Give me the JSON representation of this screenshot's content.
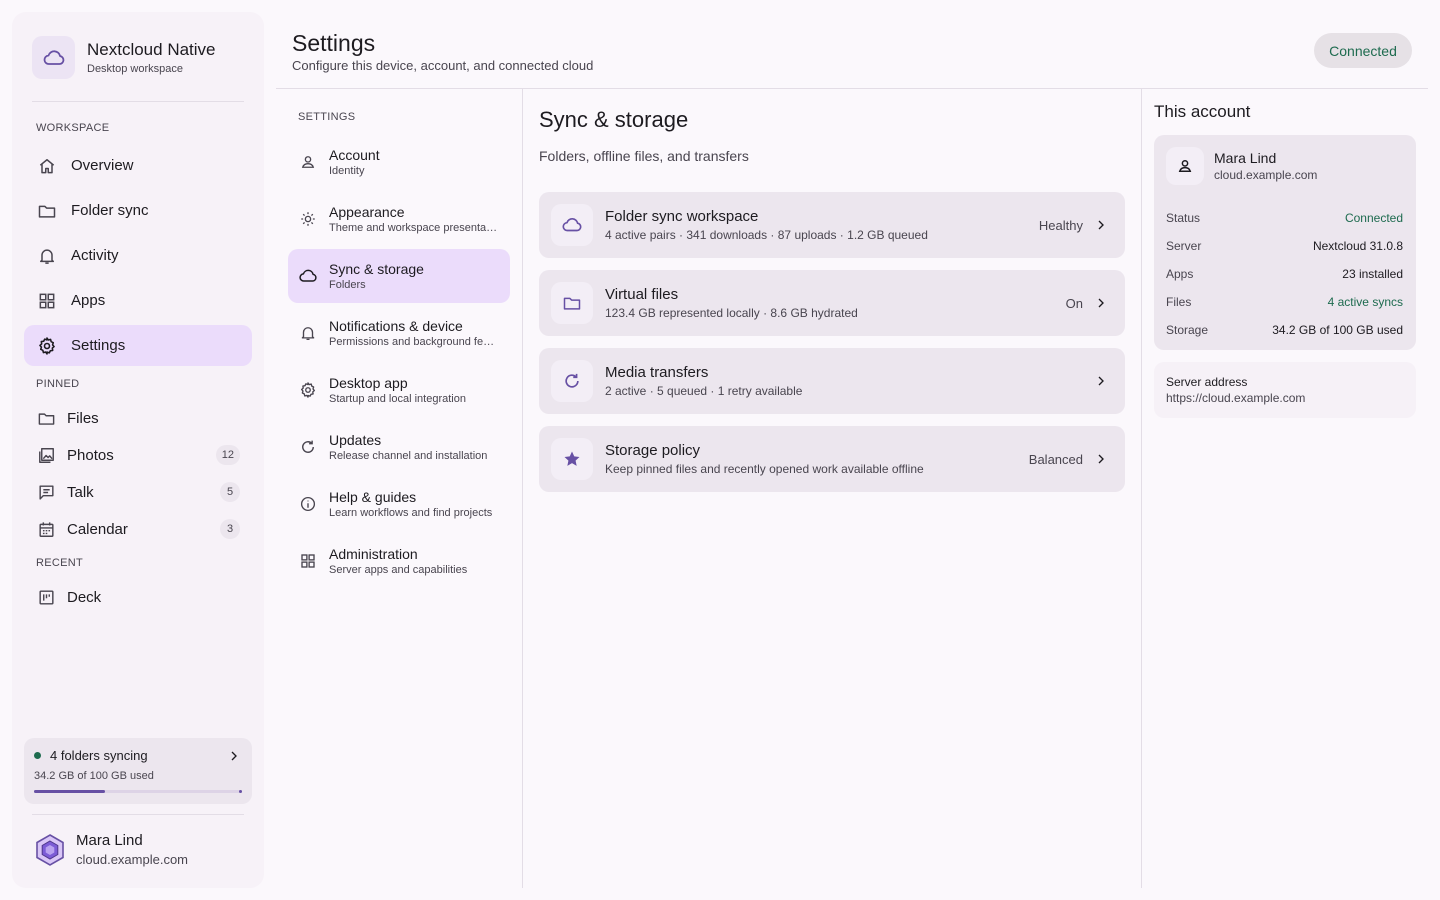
{
  "app": {
    "name": "Nextcloud Native",
    "subtitle": "Desktop workspace"
  },
  "sidebar": {
    "workspace_label": "WORKSPACE",
    "workspace_items": [
      {
        "label": "Overview",
        "icon": "home-icon"
      },
      {
        "label": "Folder sync",
        "icon": "folder-icon"
      },
      {
        "label": "Activity",
        "icon": "bell-icon"
      },
      {
        "label": "Apps",
        "icon": "grid-icon"
      },
      {
        "label": "Settings",
        "icon": "gear-icon",
        "active": true
      }
    ],
    "pinned_label": "PINNED",
    "pinned_items": [
      {
        "label": "Files",
        "icon": "folder-icon",
        "count": ""
      },
      {
        "label": "Photos",
        "icon": "photos-icon",
        "count": "12"
      },
      {
        "label": "Talk",
        "icon": "chat-icon",
        "count": "5"
      },
      {
        "label": "Calendar",
        "icon": "calendar-icon",
        "count": "3"
      }
    ],
    "recent_label": "RECENT",
    "recent_items": [
      {
        "label": "Deck",
        "icon": "deck-icon"
      }
    ],
    "sync_card": {
      "title": "4 folders syncing",
      "usage": "34.2 GB of 100 GB used",
      "progress": 0.342
    },
    "user": {
      "name": "Mara Lind",
      "host": "cloud.example.com"
    }
  },
  "header": {
    "title": "Settings",
    "subtitle": "Configure this device, account, and connected cloud",
    "status": "Connected"
  },
  "settings_nav": {
    "label": "SETTINGS",
    "items": [
      {
        "title": "Account",
        "sub": "Identity",
        "icon": "person-icon"
      },
      {
        "title": "Appearance",
        "sub": "Theme and workspace presentation",
        "icon": "sun-icon"
      },
      {
        "title": "Sync & storage",
        "sub": "Folders",
        "icon": "cloud-icon",
        "active": true
      },
      {
        "title": "Notifications & device",
        "sub": "Permissions and background features",
        "icon": "bell-icon"
      },
      {
        "title": "Desktop app",
        "sub": "Startup and local integration",
        "icon": "gear-icon"
      },
      {
        "title": "Updates",
        "sub": "Release channel and installation",
        "icon": "refresh-icon"
      },
      {
        "title": "Help & guides",
        "sub": "Learn workflows and find projects",
        "icon": "info-icon"
      },
      {
        "title": "Administration",
        "sub": "Server apps and capabilities",
        "icon": "grid-icon"
      }
    ]
  },
  "main": {
    "title": "Sync & storage",
    "subtitle": "Folders, offline files, and transfers",
    "cards": [
      {
        "title": "Folder sync workspace",
        "sub": "4 active pairs · 341 downloads · 87 uploads · 1.2 GB queued",
        "status": "Healthy",
        "icon": "cloud-icon"
      },
      {
        "title": "Virtual files",
        "sub": "123.4 GB represented locally · 8.6 GB hydrated",
        "status": "On",
        "icon": "folder-icon"
      },
      {
        "title": "Media transfers",
        "sub": "2 active · 5 queued · 1 retry available",
        "status": "",
        "icon": "refresh-icon"
      },
      {
        "title": "Storage policy",
        "sub": "Keep pinned files and recently opened work available offline",
        "status": "Balanced",
        "icon": "star-icon"
      }
    ]
  },
  "account_panel": {
    "title": "This account",
    "name": "Mara Lind",
    "host": "cloud.example.com",
    "rows": [
      {
        "key": "Status",
        "value": "Connected",
        "green": true
      },
      {
        "key": "Server",
        "value": "Nextcloud 31.0.8",
        "green": false
      },
      {
        "key": "Apps",
        "value": "23 installed",
        "green": false
      },
      {
        "key": "Files",
        "value": "4 active syncs",
        "green": true
      },
      {
        "key": "Storage",
        "value": "34.2 GB of 100 GB used",
        "green": false
      }
    ],
    "address_label": "Server address",
    "address_value": "https://cloud.example.com"
  },
  "colors": {
    "accent": "#6750a4",
    "active_bg": "#ebdcfb",
    "success": "#1e6b4f"
  }
}
